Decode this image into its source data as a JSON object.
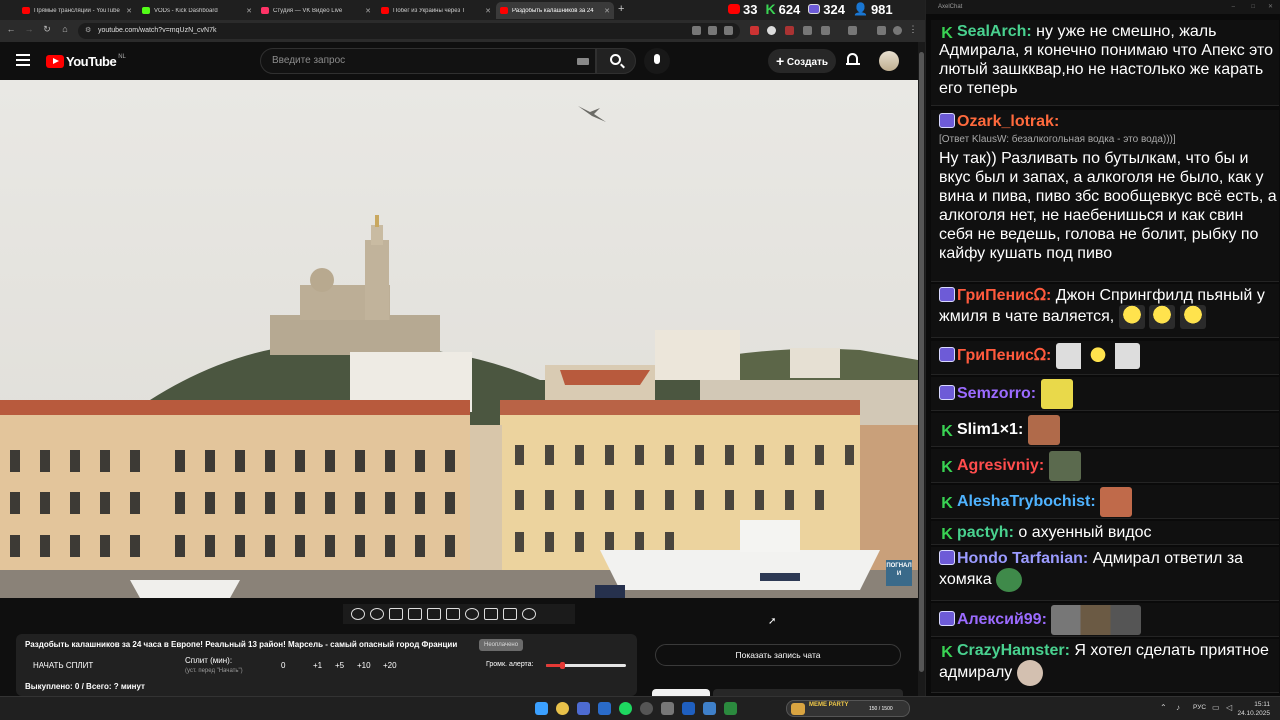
{
  "tabs": [
    {
      "title": "Прямые трансляции - YouTube",
      "color": "#ff0000"
    },
    {
      "title": "VODs - Kick Dashboard",
      "color": "#53fc18"
    },
    {
      "title": "Студия — VK Видео Live",
      "color": "#ff3366"
    },
    {
      "title": "Побег из Украины через Т",
      "color": "#ff0000"
    },
    {
      "title": "Раздобыть калашников за 24",
      "color": "#ff0000"
    }
  ],
  "new_tab": "+",
  "counters": {
    "youtube": "33",
    "kick": "624",
    "vk": "324",
    "total": "981"
  },
  "address": {
    "url": "youtube.com/watch?v=mqUzN_cvN7k"
  },
  "youtube": {
    "logo_text": "YouTube",
    "region": "NL",
    "search_placeholder": "Введите запрос",
    "create_label": "Создать"
  },
  "video": {
    "watermark": "ПОГНАЛИ"
  },
  "panel": {
    "title": "Раздобыть калашников за 24 часа в Европе! Реальный 13 район! Марсель - самый опасный город Франции",
    "title_badge": "Неоплачено",
    "start_split": "НАЧАТЬ СПЛИТ",
    "split_label": "Сплит (мин):",
    "split_hint": "(уст. перед \"Начать\")",
    "split_value": "0",
    "btn_1": "+1",
    "btn_5": "+5",
    "btn_10": "+10",
    "btn_20": "+20",
    "volume_label": "Громк. алерта:",
    "volume_level": 0.2,
    "status": "Выкуплено: 0 / Всего: ? минут"
  },
  "show_chat": "Показать запись чата",
  "chat": {
    "window_title": "AxelChat",
    "messages": [
      {
        "platform": "kick",
        "nick": "SealArch",
        "color": "#49d18f",
        "text": "ну уже не смешно, жаль Адмирала, я конечно понимаю что Апекс это лютый зашкквар,но не настолько же карать его теперь"
      },
      {
        "platform": "live",
        "nick": "Ozark_lotrak",
        "color": "#ff6a3d",
        "reply": "[Ответ KlausW: безалкогольная водка - это вода)))]",
        "text": "Ну так)) Разливать по бутылкам, что бы и вкус был и запах, а алкоголя не было, как у вина и пива, пиво збс вообщевкус всё есть, а алкоголя нет, не наебенишься и как свин себя не ведешь, голова не болит, рыбку по кайфу кушать под пиво"
      },
      {
        "platform": "kick",
        "nick": "ГриПенисᘯ",
        "color": "#ff5a3d",
        "text": "Джон Спрингфилд пьяный у жмиля в чате валяется,"
      },
      {
        "platform": "live",
        "nick": "ГриПенисᘯ",
        "color": "#ff5a3d",
        "text": ""
      },
      {
        "platform": "live",
        "nick": "Semzorro",
        "color": "#9b6bff",
        "text": ""
      },
      {
        "platform": "kick",
        "nick": "Slim1×1",
        "color": "#ffffff",
        "text": ""
      },
      {
        "platform": "kick",
        "nick": "Agresivniy",
        "color": "#ff4d4d",
        "text": ""
      },
      {
        "platform": "kick",
        "nick": "AleshaTrybochist",
        "color": "#4fb3ff",
        "text": ""
      },
      {
        "platform": "kick",
        "nick": "pactyh",
        "color": "#49d18f",
        "text": "о ахуенный видос"
      },
      {
        "platform": "live",
        "nick": "Hondo Tarfanian",
        "color": "#9b9bff",
        "text": "Адмирал ответил за хомяка"
      },
      {
        "platform": "live",
        "nick": "Алексий99",
        "color": "#9b6bff",
        "text": ""
      },
      {
        "platform": "kick",
        "nick": "CrazyHamster",
        "color": "#49d18f",
        "text": "Я хотел сделать приятное адмиралу"
      }
    ]
  },
  "taskbar": {
    "lang": "РУС",
    "time": "15:11",
    "date": "24.10.2025",
    "widget": "MEME PARTY",
    "widget_count": "150 / 1500"
  },
  "colors": {
    "youtube_red": "#ff0000",
    "kick_green": "#39d353",
    "vk_purple": "#6d5bd7"
  }
}
